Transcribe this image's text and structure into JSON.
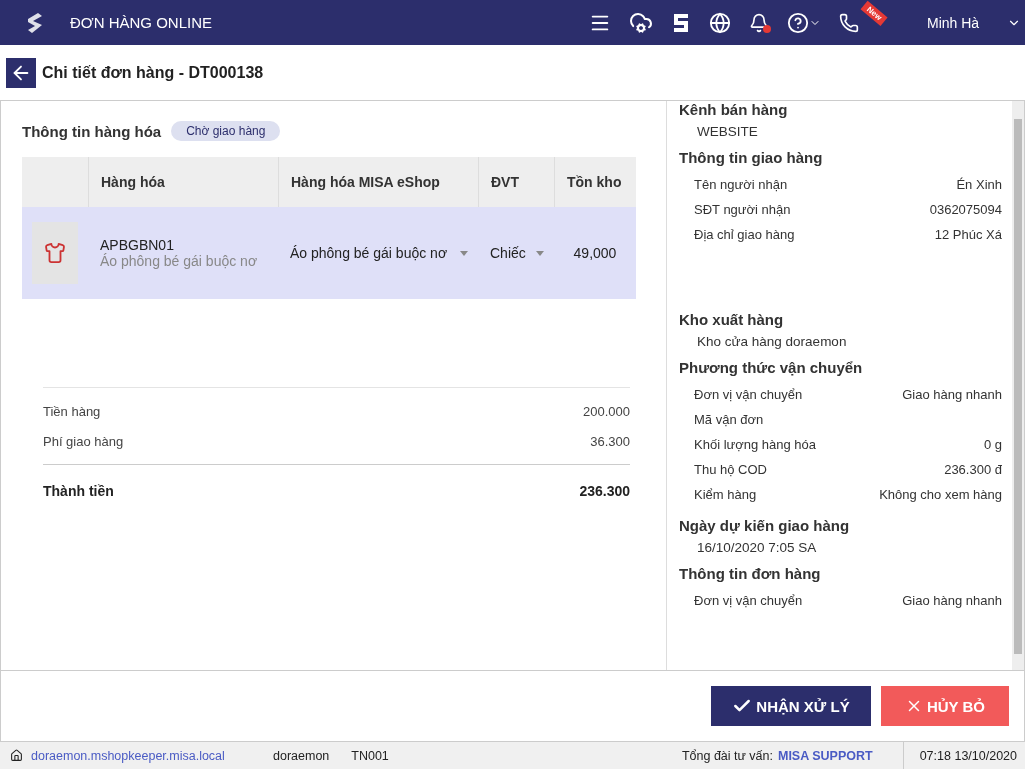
{
  "header": {
    "app_title": "ĐƠN HÀNG ONLINE",
    "new_badge": "New",
    "user_name": "Minh Hà"
  },
  "page_title": "Chi tiết đơn hàng - DT000138",
  "goods": {
    "title": "Thông tin hàng hóa",
    "status": "Chờ giao hàng",
    "columns": [
      "Hàng hóa",
      "Hàng hóa MISA eShop",
      "ĐVT",
      "Tồn kho"
    ],
    "rows": [
      {
        "code": "APBGBN01",
        "name": "Áo phông bé gái buộc nơ",
        "eshop_item": "Áo phông bé gái buộc nơ",
        "unit": "Chiếc",
        "stock": "49,000",
        "selected": true
      }
    ],
    "summary": [
      {
        "label": "Tiền hàng",
        "value": "200.000"
      },
      {
        "label": "Phí giao hàng",
        "value": "36.300"
      }
    ],
    "total": {
      "label": "Thành tiền",
      "value": "236.300"
    }
  },
  "details": [
    {
      "kind": "text",
      "title": "Kênh bán hàng",
      "text": "WEBSITE"
    },
    {
      "kind": "fields",
      "title": "Thông tin giao hàng",
      "fields": [
        {
          "label": "Tên người nhận",
          "value": "Én Xinh"
        },
        {
          "label": "SĐT người nhận",
          "value": "0362075094"
        },
        {
          "label": "Địa chỉ giao hàng",
          "value": "12 Phúc Xá"
        }
      ]
    },
    {
      "kind": "text",
      "title": "Kho xuất hàng",
      "text": "Kho cửa hàng doraemon"
    },
    {
      "kind": "fields",
      "title": "Phương thức vận chuyển",
      "fields": [
        {
          "label": "Đơn vị vận chuyển",
          "value": "Giao hàng nhanh"
        },
        {
          "label": "Mã vận đơn"
        },
        {
          "label": "Khối lượng hàng hóa",
          "value": "0 g"
        },
        {
          "label": "Thu hộ COD",
          "value": "236.300 đ"
        },
        {
          "label": "Kiểm hàng",
          "value": "Không cho xem hàng"
        }
      ]
    },
    {
      "kind": "text",
      "title": "Ngày dự kiến giao hàng",
      "text": "16/10/2020 7:05 SA"
    },
    {
      "kind": "fields",
      "title": "Thông tin đơn hàng",
      "fields": [
        {
          "label": "Đơn vị vận chuyển",
          "value": "Giao hàng nhanh"
        }
      ]
    }
  ],
  "buttons": [
    {
      "kind": "primary",
      "label": "NHẬN XỬ LÝ"
    },
    {
      "kind": "danger",
      "label": "HỦY BỎ"
    }
  ],
  "status_bar": {
    "url": "doraemon.mshopkeeper.misa.local",
    "store": "doraemon",
    "branch": "TN001",
    "hotline_label": "Tổng đài tư vấn:",
    "hotline_link": "MISA SUPPORT",
    "datetime": "07:18 13/10/2020"
  }
}
